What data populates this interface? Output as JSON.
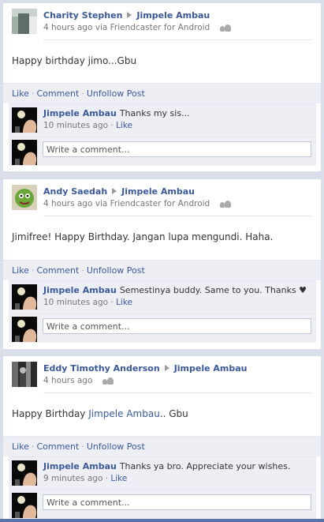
{
  "posts": [
    {
      "author": "Charity Stephen",
      "target": "Jimpele Ambau",
      "meta": "4 hours ago via Friendcaster for Android",
      "message_prefix": "Happy birthday jimo...Gbu",
      "message_link": "",
      "message_suffix": "",
      "actions": {
        "like": "Like",
        "comment": "Comment",
        "unfollow": "Unfollow Post"
      },
      "comment": {
        "author": "Jimpele Ambau",
        "text": "Thanks my sis...",
        "time": "10 minutes ago",
        "like": "Like"
      },
      "write_placeholder": "Write a comment..."
    },
    {
      "author": "Andy Saedah",
      "target": "Jimpele Ambau",
      "meta": "4 hours ago via Friendcaster for Android",
      "message_prefix": "Jimifree! Happy Birthday. Jangan lupa mengundi. Haha.",
      "message_link": "",
      "message_suffix": "",
      "actions": {
        "like": "Like",
        "comment": "Comment",
        "unfollow": "Unfollow Post"
      },
      "comment": {
        "author": "Jimpele Ambau",
        "text": "Semestinya buddy. Same to you. Thanks ♥",
        "time": "10 minutes ago",
        "like": "Like"
      },
      "write_placeholder": "Write a comment..."
    },
    {
      "author": "Eddy Timothy Anderson",
      "target": "Jimpele Ambau",
      "meta": "4 hours ago",
      "message_prefix": "Happy Birthday ",
      "message_link": "Jimpele Ambau",
      "message_suffix": ".. Gbu",
      "actions": {
        "like": "Like",
        "comment": "Comment",
        "unfollow": "Unfollow Post"
      },
      "comment": {
        "author": "Jimpele Ambau",
        "text": "Thanks ya bro. Appreciate your wishes.",
        "time": "9 minutes ago",
        "like": "Like"
      },
      "write_placeholder": "Write a comment..."
    }
  ]
}
